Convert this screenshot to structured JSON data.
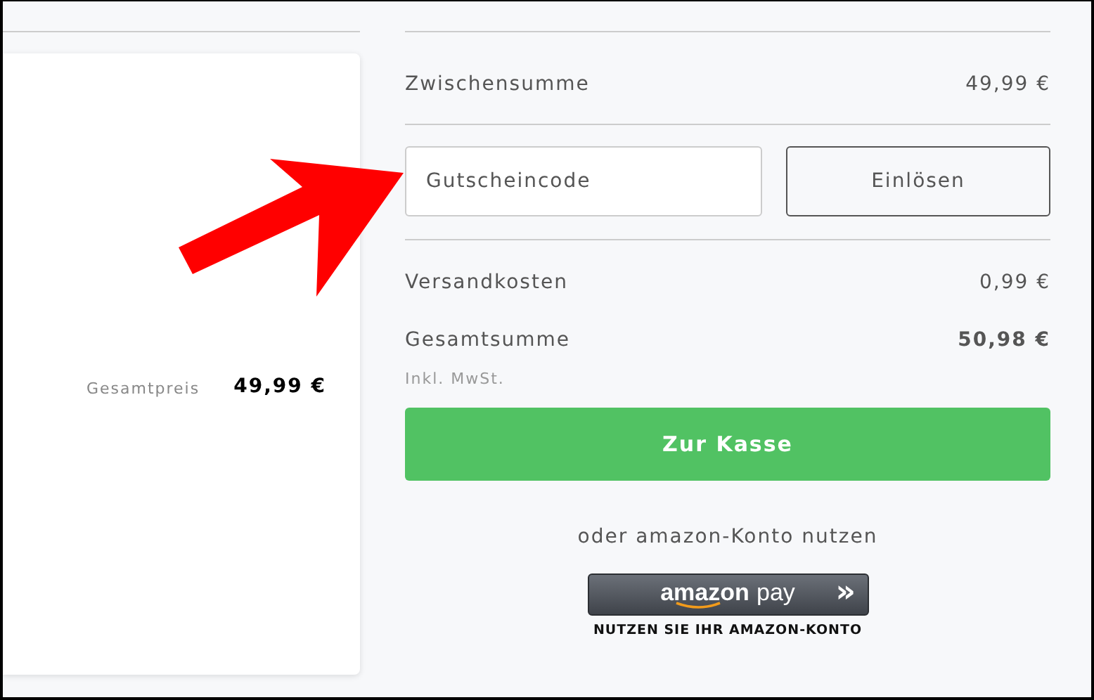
{
  "product_card": {
    "total_label": "Gesamtpreis",
    "total_value": "49,99 €"
  },
  "summary": {
    "subtotal_label": "Zwischensumme",
    "subtotal_value": "49,99 €",
    "coupon": {
      "placeholder": "Gutscheincode",
      "button": "Einlösen"
    },
    "shipping_label": "Versandkosten",
    "shipping_value": "0,99 €",
    "total_label": "Gesamtsumme",
    "total_value": "50,98 €",
    "tax_note": "Inkl. MwSt.",
    "checkout_button": "Zur Kasse",
    "alt_text": "oder amazon-Konto nutzen",
    "amazon_pay": {
      "brand": "amazon",
      "word": "pay",
      "chevron": "»",
      "caption": "NUTZEN SIE IHR AMAZON-KONTO"
    }
  }
}
